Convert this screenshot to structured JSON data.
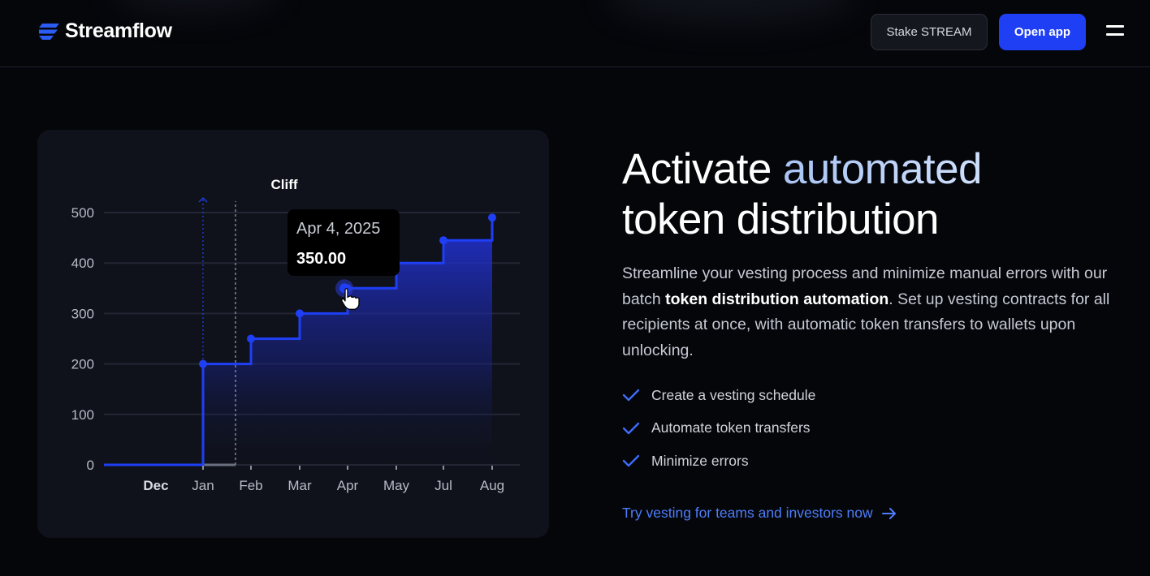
{
  "header": {
    "logo_text": "Streamflow",
    "stake_label": "Stake STREAM",
    "open_app_label": "Open app"
  },
  "chart_data": {
    "type": "line",
    "step": true,
    "title": "",
    "annotation": "Cliff",
    "categories": [
      "Dec",
      "Jan",
      "Feb",
      "Mar",
      "Apr",
      "May",
      "Jul",
      "Aug"
    ],
    "y_ticks": [
      0,
      100,
      200,
      300,
      400,
      500
    ],
    "ylim": [
      0,
      500
    ],
    "series": [
      {
        "points": [
          {
            "x": "Jan",
            "y": 200
          },
          {
            "x": "Feb",
            "y": 250
          },
          {
            "x": "Mar",
            "y": 300
          },
          {
            "x": "Apr",
            "y": 350
          },
          {
            "x": "May",
            "y": 400
          },
          {
            "x": "Jul",
            "y": 445
          },
          {
            "x": "Aug",
            "y": 490
          }
        ]
      }
    ],
    "tooltip": {
      "date": "Apr 4, 2025",
      "value": "350.00"
    },
    "grid": true,
    "accent_color": "#1f3ff5"
  },
  "hero": {
    "title_part1": "Activate ",
    "title_accent": "automated",
    "title_part2": "token distribution",
    "desc_part1": "Streamline your vesting process and minimize manual errors with our batch ",
    "desc_bold": "token distribution automation",
    "desc_part2": ". Set up vesting contracts for all recipients at once, with automatic token transfers to wallets upon unlocking.",
    "features": [
      "Create a vesting schedule",
      "Automate token transfers",
      "Minimize errors"
    ],
    "cta_label": "Try vesting for teams and investors now"
  }
}
